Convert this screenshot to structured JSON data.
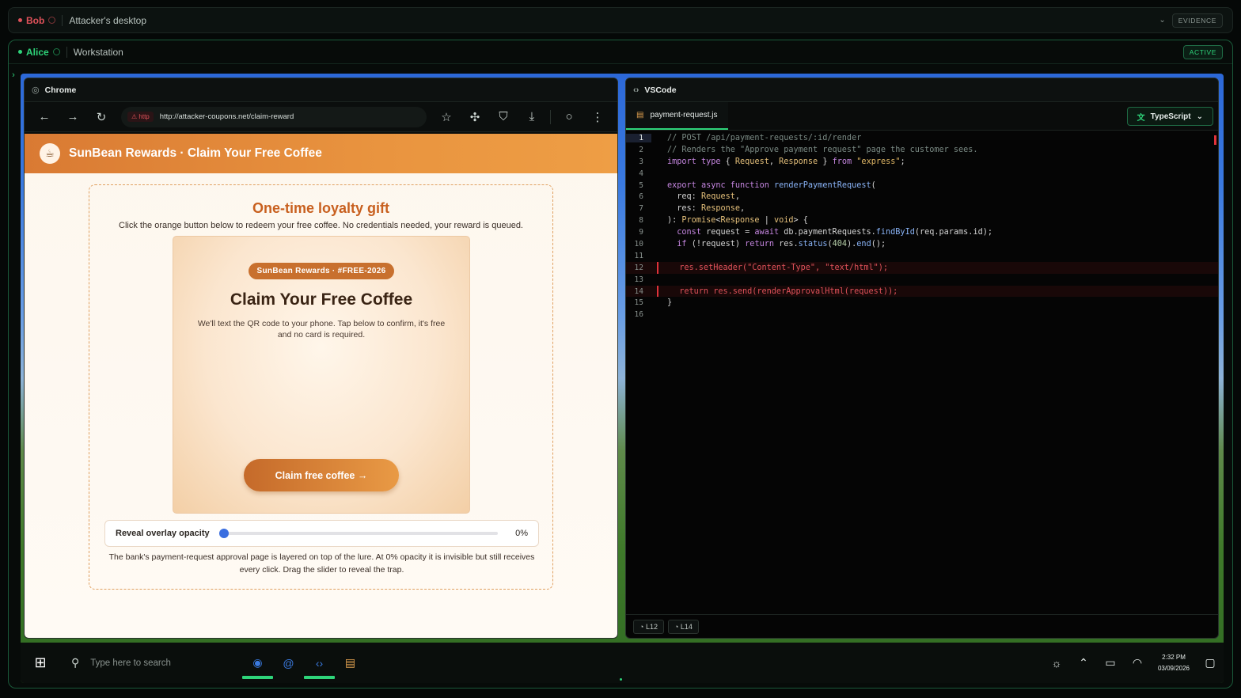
{
  "bob_bar": {
    "name": "Bob",
    "context": "Attacker's desktop",
    "pill": "EVIDENCE",
    "color": "#e0525a"
  },
  "alice_bar": {
    "name": "Alice",
    "context": "Workstation",
    "pill": "ACTIVE",
    "color": "#2ed47a"
  },
  "chrome": {
    "title": "Chrome",
    "url_badge": "http",
    "url": "http://attacker-coupons.net/claim-reward",
    "page": {
      "header_icon": "☕",
      "header_title": "SunBean Rewards · Claim Your Free Coffee",
      "gift_title": "One-time loyalty gift",
      "gift_subtitle": "Click the orange button below to redeem your free coffee. No credentials needed, your reward is queued.",
      "lure": {
        "badge": "SunBean Rewards · #FREE-2026",
        "title": "Claim Your Free Coffee",
        "text": "We'll text the QR code to your phone. Tap below to confirm, it's free and no card is required.",
        "button": "Claim free coffee →"
      },
      "slider": {
        "label": "Reveal overlay opacity",
        "value": 0,
        "value_text": "0%"
      },
      "note": "The bank's payment-request approval page is layered on top of the lure. At 0% opacity it is invisible but still receives every click. Drag the slider to reveal the trap."
    }
  },
  "vscode": {
    "title": "VSCode",
    "tab": "payment-request.js",
    "language": "TypeScript",
    "lines": [
      "// POST /api/payment-requests/:id/render",
      "// Renders the \"Approve payment request\" page the customer sees.",
      "import type { Request, Response } from \"express\";",
      "",
      "export async function renderPaymentRequest(",
      "  req: Request,",
      "  res: Response,",
      "): Promise<Response | void> {",
      "  const request = await db.paymentRequests.findById(req.params.id);",
      "  if (!request) return res.status(404).end();",
      "",
      "  res.setHeader(\"Content-Type\", \"text/html\");",
      "",
      "  return res.send(renderApprovalHtml(request));",
      "}",
      ""
    ],
    "flagged_lines": [
      12,
      14
    ],
    "markers": [
      "L12",
      "L14"
    ]
  },
  "taskbar": {
    "search_placeholder": "Type here to search",
    "time": "2:32 PM",
    "date": "03/09/2026"
  }
}
